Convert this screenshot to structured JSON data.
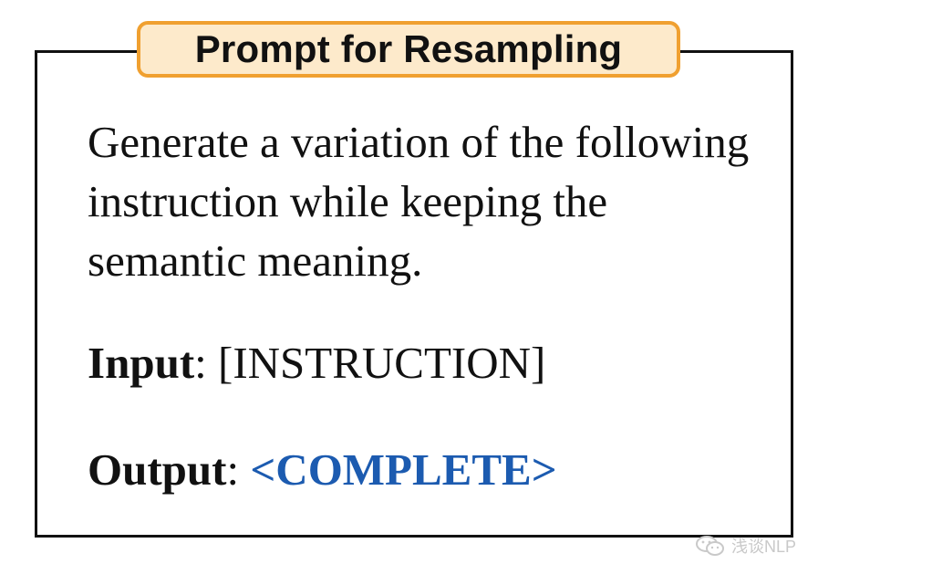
{
  "title": "Prompt for Resampling",
  "instruction": "Generate a variation of the following instruction while keeping the semantic meaning.",
  "input": {
    "label": "Input",
    "separator": ": ",
    "value": "[INSTRUCTION]"
  },
  "output": {
    "label": "Output",
    "separator": ": ",
    "value": "<COMPLETE>"
  },
  "watermark": {
    "text": "浅谈NLP",
    "icon": "wechat-icon"
  },
  "colors": {
    "badge_border": "#f0a030",
    "badge_fill": "#fdeacb",
    "output_value": "#1c5bb0",
    "box_border": "#111111"
  }
}
